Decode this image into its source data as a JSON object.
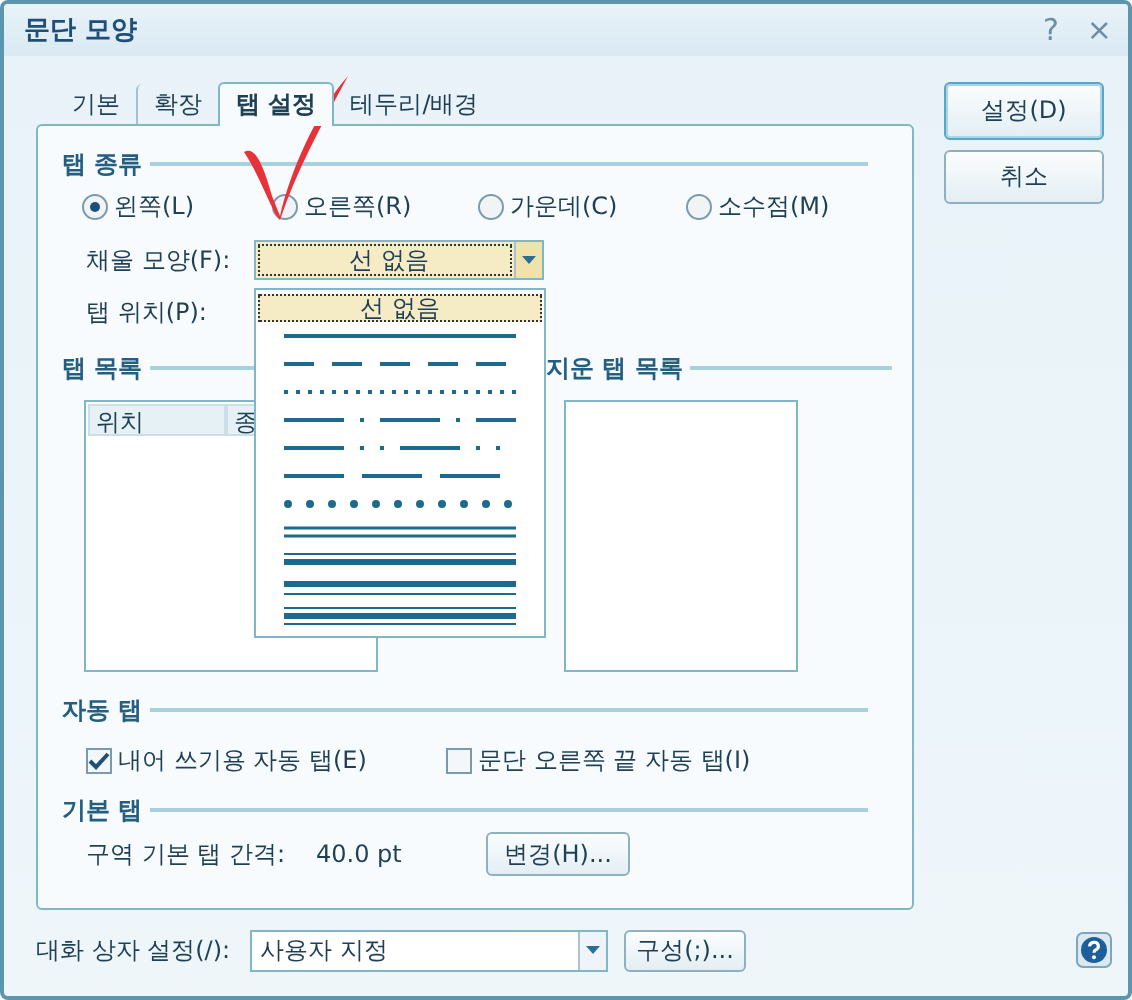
{
  "window": {
    "title": "문단 모양"
  },
  "title_buttons": [
    "?",
    "×"
  ],
  "tabs": [
    {
      "label": "기본",
      "selected": false
    },
    {
      "label": "확장",
      "selected": false
    },
    {
      "label": "탭 설정",
      "selected": true
    },
    {
      "label": "테두리/배경",
      "selected": false
    }
  ],
  "tab_type": {
    "heading": "탭 종류",
    "options": [
      {
        "label": "왼쪽(L)",
        "selected": true
      },
      {
        "label": "오른쪽(R)",
        "selected": false
      },
      {
        "label": "가운데(C)",
        "selected": false
      },
      {
        "label": "소수점(M)",
        "selected": false
      }
    ]
  },
  "fill": {
    "label": "채울 모양(F):",
    "value": "선 없음"
  },
  "fill_list": [
    {
      "kind": "text",
      "label": "선 없음",
      "selected": true
    },
    {
      "kind": "line",
      "selected": false
    },
    {
      "kind": "line",
      "selected": false
    },
    {
      "kind": "line",
      "selected": false
    },
    {
      "kind": "line",
      "selected": false
    },
    {
      "kind": "line",
      "selected": false
    },
    {
      "kind": "line",
      "selected": false
    },
    {
      "kind": "line",
      "selected": false
    },
    {
      "kind": "line",
      "selected": false
    },
    {
      "kind": "line",
      "selected": false
    },
    {
      "kind": "line",
      "selected": false
    },
    {
      "kind": "line",
      "selected": false
    }
  ],
  "tab_position": {
    "label": "탭 위치(P):"
  },
  "tab_list": {
    "heading": "탭 목록",
    "columns": [
      "위치",
      "종"
    ]
  },
  "deleted_list": {
    "heading": "지운 탭 목록"
  },
  "auto_tab": {
    "heading": "자동 탭",
    "options": [
      {
        "label": "내어 쓰기용 자동 탭(E)",
        "checked": true
      },
      {
        "label": "문단 오른쪽 끝 자동 탭(I)",
        "checked": false
      }
    ]
  },
  "default_tab": {
    "heading": "기본 탭",
    "label": "구역 기본 탭 간격:",
    "value": "40.0 pt",
    "button": "변경(H)..."
  },
  "buttons": [
    {
      "label": "설정(D)",
      "default": true
    },
    {
      "label": "취소",
      "default": false
    }
  ],
  "footer": {
    "label": "대화 상자 설정(/):",
    "value": "사용자 지정",
    "button": "구성(;)..."
  }
}
